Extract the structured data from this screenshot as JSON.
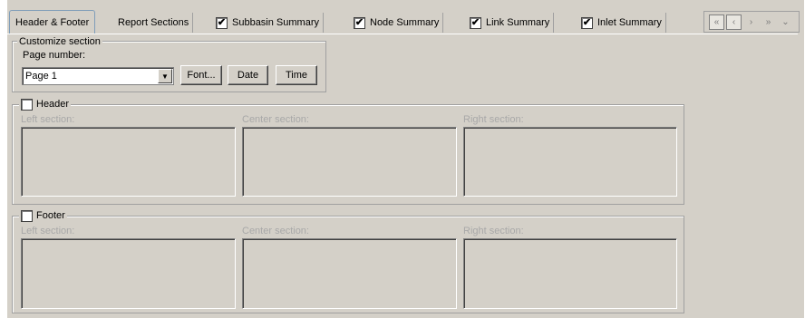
{
  "tabs": [
    {
      "label": "Header & Footer",
      "active": true,
      "has_checkbox": false,
      "checked": false
    },
    {
      "label": "Report Sections",
      "active": false,
      "has_checkbox": false,
      "checked": false
    },
    {
      "label": "Subbasin Summary",
      "active": false,
      "has_checkbox": true,
      "checked": true
    },
    {
      "label": "Node Summary",
      "active": false,
      "has_checkbox": true,
      "checked": true
    },
    {
      "label": "Link Summary",
      "active": false,
      "has_checkbox": true,
      "checked": true
    },
    {
      "label": "Inlet Summary",
      "active": false,
      "has_checkbox": true,
      "checked": true
    }
  ],
  "nav": {
    "first_icon": "double-left-arrow",
    "prev_icon": "left-arrow",
    "next_icon": "right-arrow",
    "last_icon": "double-right-arrow",
    "menu_icon": "chevron-down"
  },
  "customize": {
    "title": "Customize section",
    "page_number_label": "Page number:",
    "page_number_value": "Page 1",
    "font_button": "Font...",
    "date_button": "Date",
    "time_button": "Time"
  },
  "header": {
    "title": "Header",
    "checked": false,
    "left_label": "Left section:",
    "center_label": "Center section:",
    "right_label": "Right section:"
  },
  "footer": {
    "title": "Footer",
    "checked": false,
    "left_label": "Left section:",
    "center_label": "Center section:",
    "right_label": "Right section:"
  },
  "colors": {
    "face": "#d4d0c8",
    "active_tab_border": "#7f9db9",
    "disabled_text": "#a8a8a8"
  }
}
